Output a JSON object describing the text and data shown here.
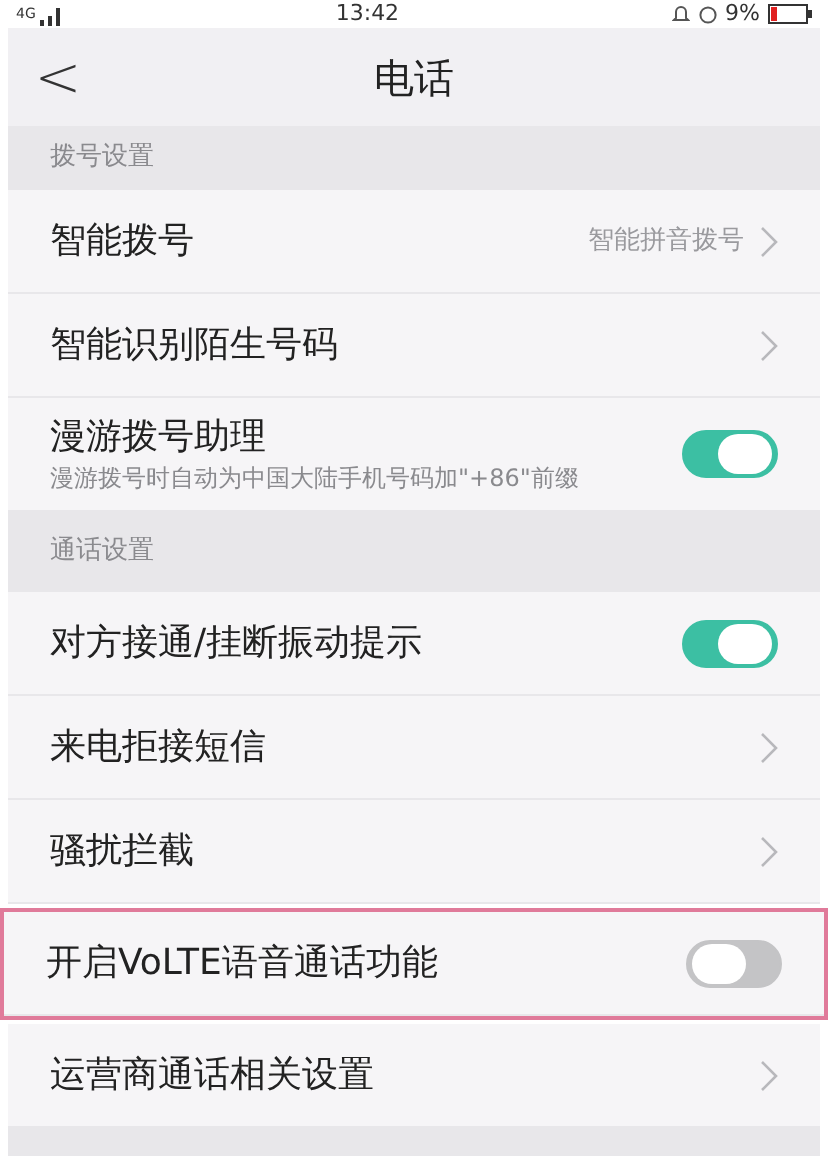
{
  "status_bar": {
    "network": "4G",
    "time": "13:42",
    "battery": "9%"
  },
  "header": {
    "back": "<",
    "title": "电话"
  },
  "sections": [
    {
      "title": "拨号设置",
      "items": [
        {
          "kind": "nav",
          "label": "智能拨号",
          "value": "智能拼音拨号",
          "highlighted": false
        },
        {
          "kind": "nav",
          "label": "智能识别陌生号码",
          "highlighted": false
        },
        {
          "kind": "toggle",
          "label": "漫游拨号助理",
          "description": "漫游拨号时自动为中国大陆手机号码加\"+86\"前缀",
          "on": true,
          "highlighted": false
        }
      ]
    },
    {
      "title": "通话设置",
      "items": [
        {
          "kind": "toggle",
          "label": "对方接通/挂断振动提示",
          "on": true,
          "highlighted": false
        },
        {
          "kind": "nav",
          "label": "来电拒接短信",
          "highlighted": false
        },
        {
          "kind": "nav",
          "label": "骚扰拦截",
          "highlighted": false
        },
        {
          "kind": "toggle",
          "label": "开启VoLTE语音通话功能",
          "on": false,
          "highlighted": true
        },
        {
          "kind": "nav",
          "label": "运营商通话相关设置",
          "highlighted": false
        }
      ]
    }
  ]
}
